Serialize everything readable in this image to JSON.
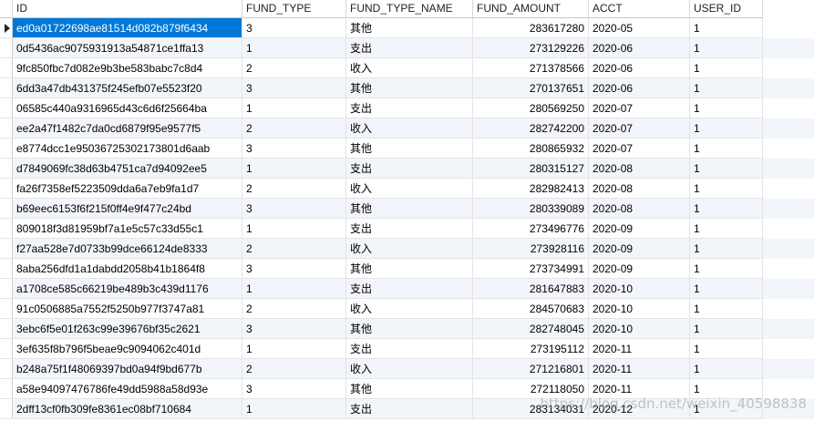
{
  "columns": [
    "ID",
    "FUND_TYPE",
    "FUND_TYPE_NAME",
    "FUND_AMOUNT",
    "ACCT",
    "USER_ID"
  ],
  "rows": [
    [
      "ed0a01722698ae81514d082b879f6434",
      "3",
      "其他",
      "283617280",
      "2020-05",
      "1"
    ],
    [
      "0d5436ac9075931913a54871ce1ffa13",
      "1",
      "支出",
      "273129226",
      "2020-06",
      "1"
    ],
    [
      "9fc850fbc7d082e9b3be583babc7c8d4",
      "2",
      "收入",
      "271378566",
      "2020-06",
      "1"
    ],
    [
      "6dd3a47db431375f245efb07e5523f20",
      "3",
      "其他",
      "270137651",
      "2020-06",
      "1"
    ],
    [
      "06585c440a9316965d43c6d6f25664ba",
      "1",
      "支出",
      "280569250",
      "2020-07",
      "1"
    ],
    [
      "ee2a47f1482c7da0cd6879f95e9577f5",
      "2",
      "收入",
      "282742200",
      "2020-07",
      "1"
    ],
    [
      "e8774dcc1e95036725302173801d6aab",
      "3",
      "其他",
      "280865932",
      "2020-07",
      "1"
    ],
    [
      "d7849069fc38d63b4751ca7d94092ee5",
      "1",
      "支出",
      "280315127",
      "2020-08",
      "1"
    ],
    [
      "fa26f7358ef5223509dda6a7eb9fa1d7",
      "2",
      "收入",
      "282982413",
      "2020-08",
      "1"
    ],
    [
      "b69eec6153f6f215f0ff4e9f477c24bd",
      "3",
      "其他",
      "280339089",
      "2020-08",
      "1"
    ],
    [
      "809018f3d81959bf7a1e5c57c33d55c1",
      "1",
      "支出",
      "273496776",
      "2020-09",
      "1"
    ],
    [
      "f27aa528e7d0733b99dce66124de8333",
      "2",
      "收入",
      "273928116",
      "2020-09",
      "1"
    ],
    [
      "8aba256dfd1a1dabdd2058b41b1864f8",
      "3",
      "其他",
      "273734991",
      "2020-09",
      "1"
    ],
    [
      "a1708ce585c66219be489b3c439d1176",
      "1",
      "支出",
      "281647883",
      "2020-10",
      "1"
    ],
    [
      "91c0506885a7552f5250b977f3747a81",
      "2",
      "收入",
      "284570683",
      "2020-10",
      "1"
    ],
    [
      "3ebc6f5e01f263c99e39676bf35c2621",
      "3",
      "其他",
      "282748045",
      "2020-10",
      "1"
    ],
    [
      "3ef635f8b796f5beae9c9094062c401d",
      "1",
      "支出",
      "273195112",
      "2020-11",
      "1"
    ],
    [
      "b248a75f1f48069397bd0a94f9bd677b",
      "2",
      "收入",
      "271216801",
      "2020-11",
      "1"
    ],
    [
      "a58e94097476786fe49dd5988a58d93e",
      "3",
      "其他",
      "272118050",
      "2020-11",
      "1"
    ],
    [
      "2dff13cf0fb309fe8361ec08bf710684",
      "1",
      "支出",
      "283134031",
      "2020-12",
      "1"
    ]
  ],
  "selected_row": 0,
  "watermark": "https://blog.csdn.net/weixin_40598838",
  "colors": {
    "selection": "#0078d7",
    "row_alt": "#f2f6fb"
  }
}
